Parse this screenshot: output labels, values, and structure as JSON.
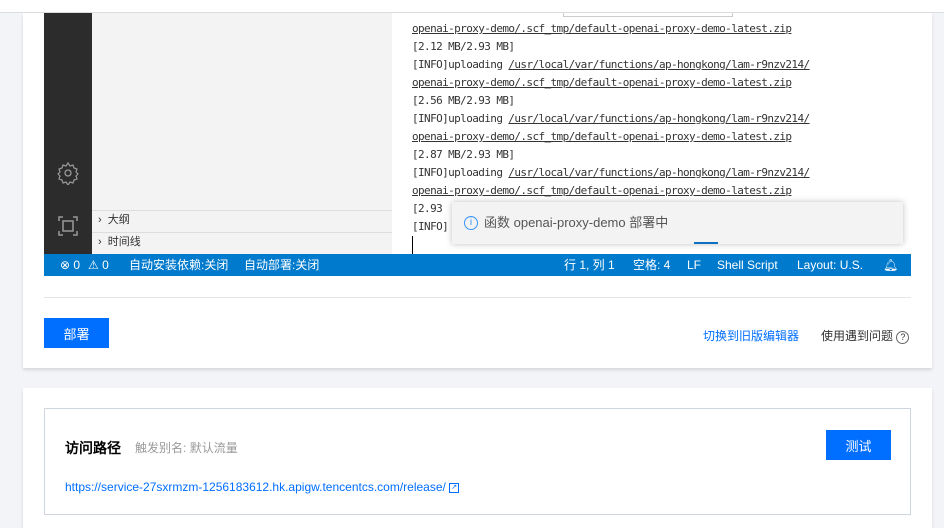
{
  "sidebar": {
    "outline": "大纲",
    "timeline": "时间线"
  },
  "terminal": {
    "lines": [
      {
        "text": "openai-proxy-demo/.scf_tmp/default-openai-proxy-demo-latest.zip",
        "underline": true
      },
      {
        "text": "[2.12 MB/2.93 MB]"
      },
      {
        "prefix": "[INFO]uploading ",
        "text": "/usr/local/var/functions/ap-hongkong/lam-r9nzv214/",
        "underline": true
      },
      {
        "text": "openai-proxy-demo/.scf_tmp/default-openai-proxy-demo-latest.zip",
        "underline": true
      },
      {
        "text": "[2.56 MB/2.93 MB]"
      },
      {
        "prefix": "[INFO]uploading ",
        "text": "/usr/local/var/functions/ap-hongkong/lam-r9nzv214/",
        "underline": true
      },
      {
        "text": "openai-proxy-demo/.scf_tmp/default-openai-proxy-demo-latest.zip",
        "underline": true
      },
      {
        "text": "[2.87 MB/2.93 MB]"
      },
      {
        "prefix": "[INFO]uploading ",
        "text": "/usr/local/var/functions/ap-hongkong/lam-r9nzv214/",
        "underline": true
      },
      {
        "text": "openai-proxy-demo/.scf_tmp/default-openai-proxy-demo-latest.zip",
        "underline": true
      },
      {
        "text": "[2.93"
      },
      {
        "text": "[INFO]"
      }
    ]
  },
  "toast": {
    "message": "函数 openai-proxy-demo 部署中"
  },
  "status": {
    "errors": "⊗ 0",
    "warnings": "⚠ 0",
    "auto_install": "自动安装依赖:关闭",
    "auto_deploy": "自动部署:关闭",
    "position": "行 1, 列 1",
    "spaces": "空格: 4",
    "eol": "LF",
    "language": "Shell Script",
    "layout": "Layout: U.S."
  },
  "actions": {
    "deploy": "部署",
    "switch_editor": "切换到旧版编辑器",
    "help": "使用遇到问题"
  },
  "access": {
    "title": "访问路径",
    "alias_label": "触发别名:",
    "alias_value": "默认流量",
    "test": "测试",
    "url": "https://service-27sxrmzm-1256183612.hk.apigw.tencentcs.com/release/"
  },
  "colors": {
    "accent": "#006eff",
    "statusbar": "#007acc"
  }
}
